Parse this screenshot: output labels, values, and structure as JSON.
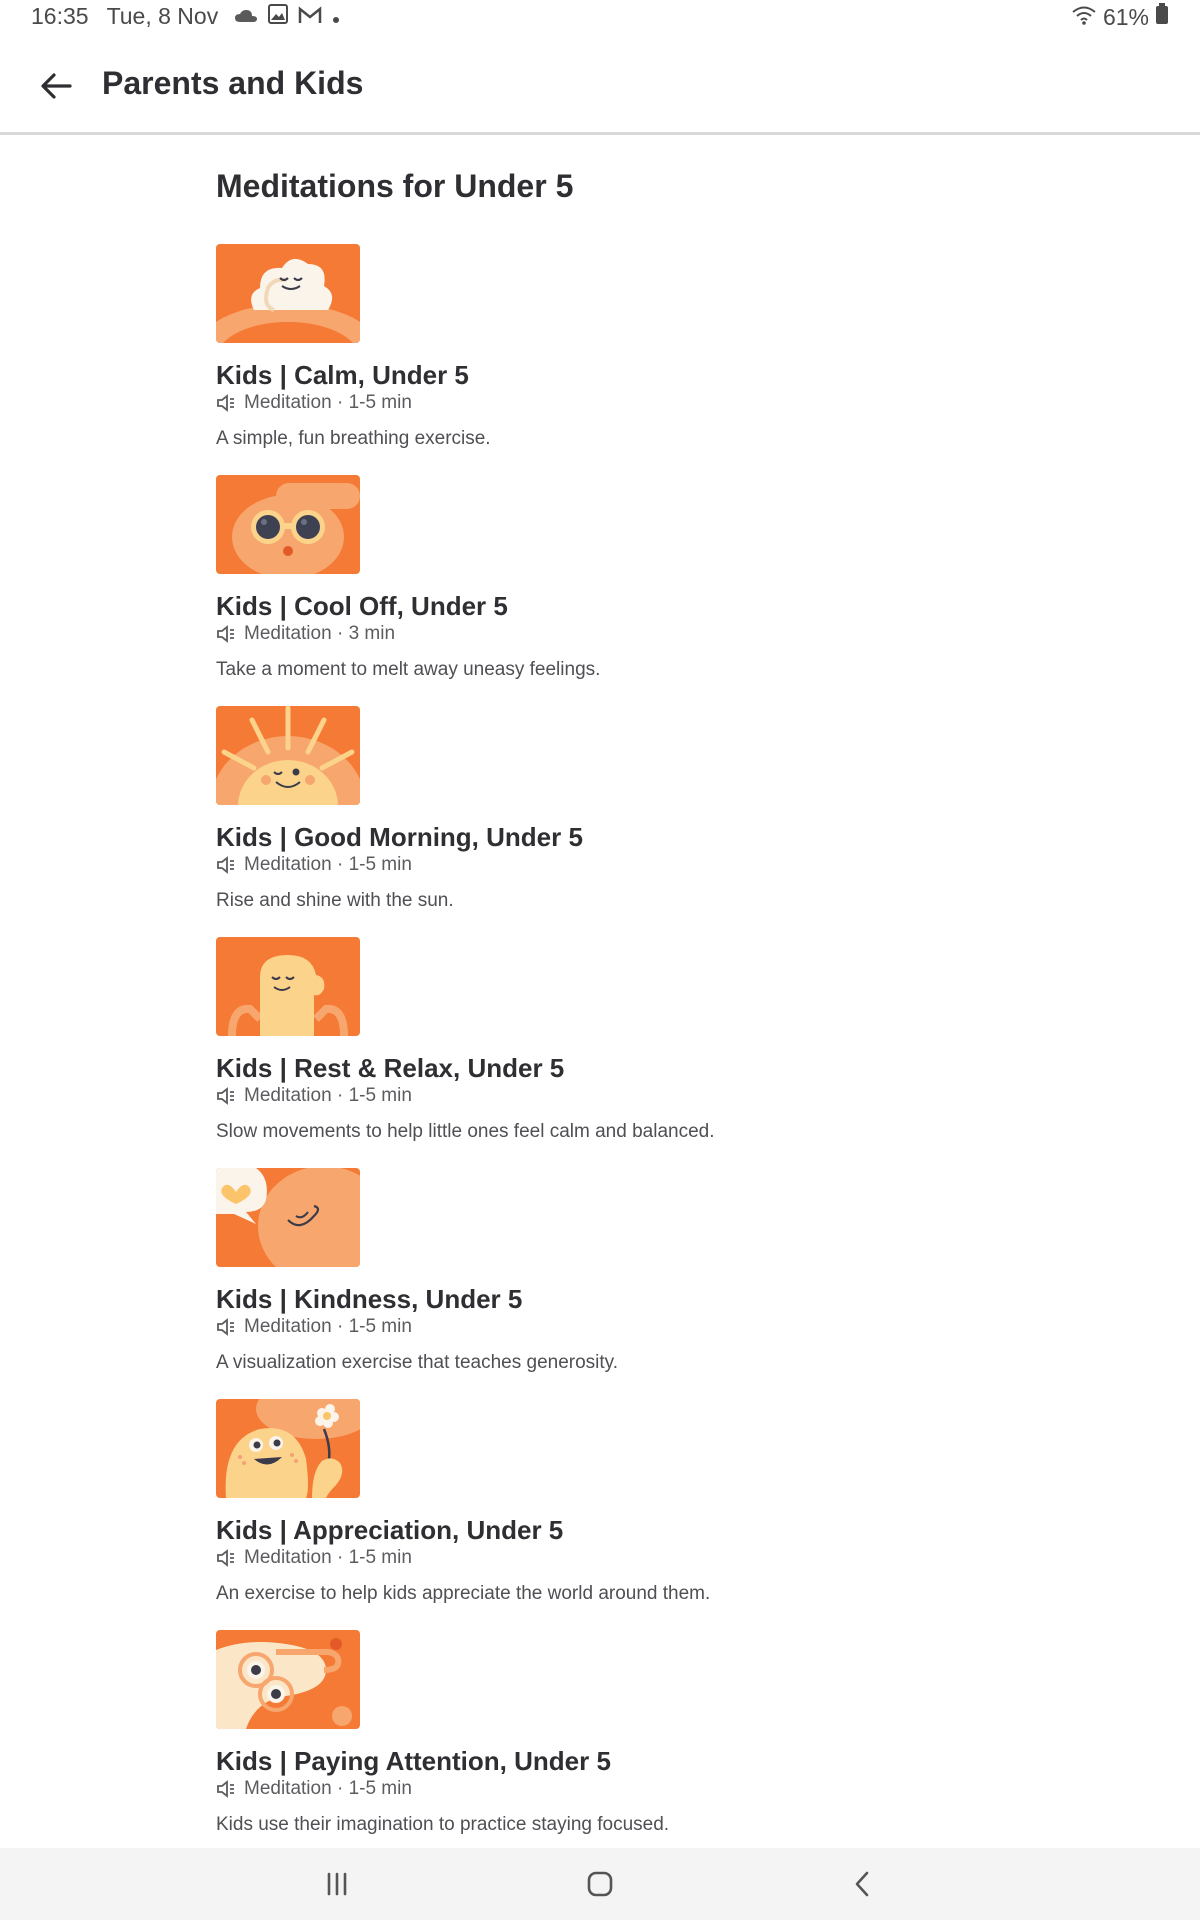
{
  "status": {
    "time": "16:35",
    "date": "Tue, 8 Nov",
    "battery": "61%",
    "icons": [
      "cloud-icon",
      "gallery-icon",
      "gmail-icon",
      "notification-dot-icon",
      "wifi-icon",
      "battery-icon"
    ]
  },
  "header": {
    "title": "Parents and Kids",
    "back_icon": "arrow-left-icon"
  },
  "section": {
    "title": "Meditations for Under 5"
  },
  "colors": {
    "accent_orange": "#f47a35",
    "light_orange": "#f7a66d",
    "face_yellow": "#fcd38b"
  },
  "items": [
    {
      "title": "Kids | Calm, Under 5",
      "type": "Meditation",
      "duration": "1-5 min",
      "description": "A simple, fun breathing exercise.",
      "thumb": "cloud-face"
    },
    {
      "title": "Kids | Cool Off, Under 5",
      "type": "Meditation",
      "duration": "3 min",
      "description": "Take a moment to melt away uneasy feelings.",
      "thumb": "sunglasses-face"
    },
    {
      "title": "Kids | Good Morning, Under 5",
      "type": "Meditation",
      "duration": "1-5 min",
      "description": "Rise and shine with the sun.",
      "thumb": "rising-sun"
    },
    {
      "title": "Kids | Rest & Relax, Under 5",
      "type": "Meditation",
      "duration": "1-5 min",
      "description": "Slow movements to help little ones feel calm and balanced.",
      "thumb": "relaxed-character"
    },
    {
      "title": "Kids | Kindness, Under 5",
      "type": "Meditation",
      "duration": "1-5 min",
      "description": "A visualization exercise that teaches generosity.",
      "thumb": "heart-bubble"
    },
    {
      "title": "Kids | Appreciation, Under 5",
      "type": "Meditation",
      "duration": "1-5 min",
      "description": "An exercise to help kids appreciate the world around them.",
      "thumb": "flower-character"
    },
    {
      "title": "Kids | Paying Attention, Under 5",
      "type": "Meditation",
      "duration": "1-5 min",
      "description": "Kids use their imagination to practice staying focused.",
      "thumb": "binoculars-character"
    }
  ],
  "meta_separator": "·",
  "nav": {
    "buttons": [
      "recent-apps-icon",
      "home-icon",
      "back-icon"
    ]
  }
}
